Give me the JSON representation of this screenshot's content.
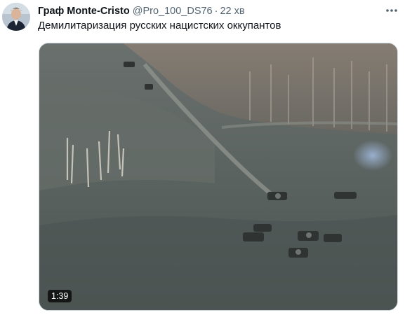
{
  "tweet": {
    "author_name": "Граф Monte-Cristo",
    "handle": "@Pro_100_DS76",
    "separator": "·",
    "time": "22 хв",
    "text": "Демилитаризация русских нацистских оккупантов",
    "more_icon": "more-horizontal-icon",
    "media": {
      "type": "video",
      "duration": "1:39"
    }
  },
  "colors": {
    "name_text": "#0f1419",
    "secondary_text": "#536471",
    "duration_badge_bg": "rgba(0,0,0,0.72)"
  }
}
